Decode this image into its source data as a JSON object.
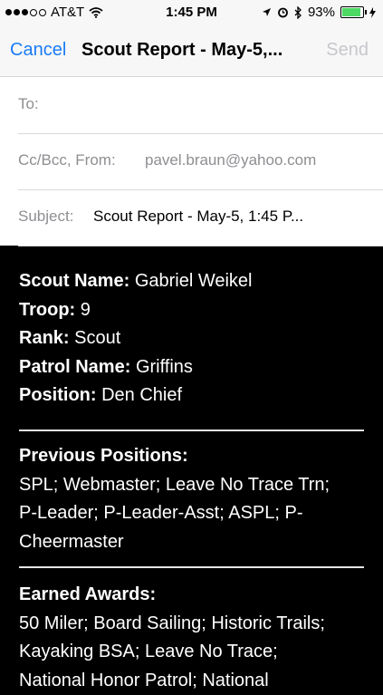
{
  "status": {
    "carrier": "AT&T",
    "time": "1:45 PM",
    "battery": "93%"
  },
  "nav": {
    "cancel": "Cancel",
    "title": "Scout Report - May-5,...",
    "send": "Send"
  },
  "fields": {
    "to_label": "To:",
    "ccbcc_label": "Cc/Bcc, From:",
    "from_value": "pavel.braun@yahoo.com",
    "subject_label": "Subject:",
    "subject_value": "Scout Report - May-5, 1:45 P..."
  },
  "report": {
    "name_label": "Scout Name:",
    "name": "Gabriel Weikel",
    "troop_label": "Troop:",
    "troop": "9",
    "rank_label": "Rank:",
    "rank": "Scout",
    "patrol_label": "Patrol Name:",
    "patrol": "Griffins",
    "position_label": "Position:",
    "position": "Den Chief",
    "prev_heading": "Previous Positions:",
    "prev_lines": [
      "SPL; Webmaster; Leave No Trace Trn;",
      "P-Leader; P-Leader-Asst; ASPL; P-",
      "Cheermaster"
    ],
    "awards_heading": "Earned Awards:",
    "awards_lines": [
      "50 Miler; Board Sailing; Historic Trails;",
      "Kayaking BSA; Leave No Trace;",
      "National Honor Patrol; National"
    ]
  }
}
